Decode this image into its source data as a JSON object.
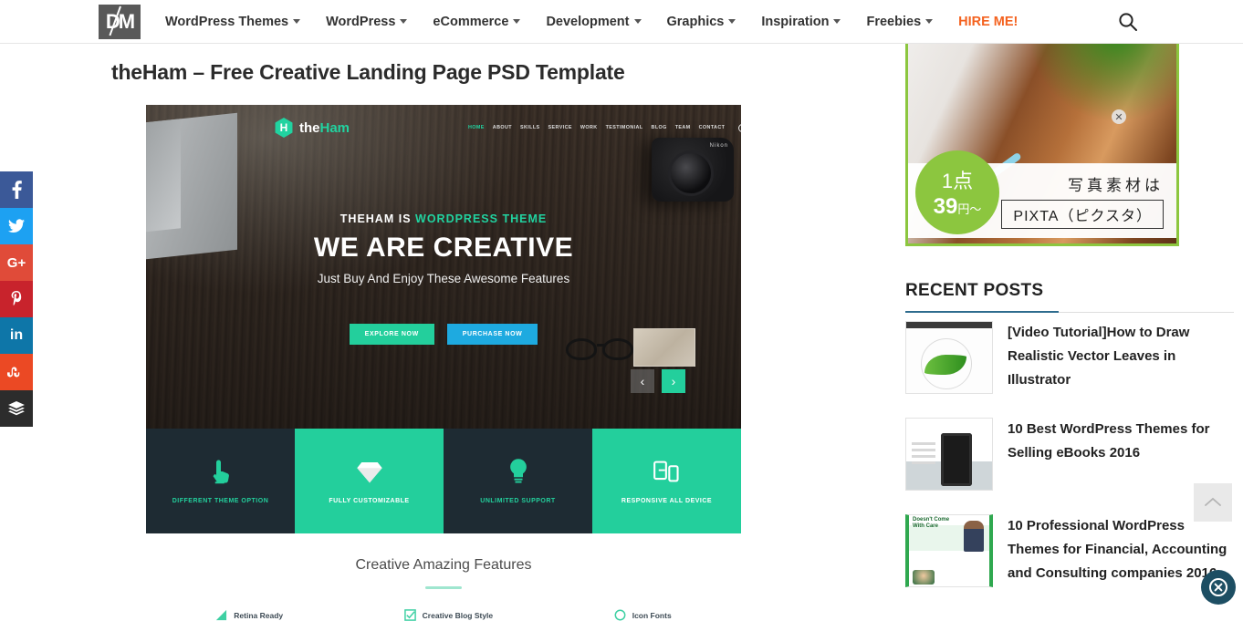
{
  "header": {
    "logo_text": "DM",
    "nav": [
      {
        "label": "WordPress Themes",
        "has_caret": true
      },
      {
        "label": "WordPress",
        "has_caret": true
      },
      {
        "label": "eCommerce",
        "has_caret": true
      },
      {
        "label": "Development",
        "has_caret": true
      },
      {
        "label": "Graphics",
        "has_caret": true
      },
      {
        "label": "Inspiration",
        "has_caret": true
      },
      {
        "label": "Freebies",
        "has_caret": true
      },
      {
        "label": "HIRE ME!",
        "has_caret": false
      }
    ],
    "search_icon": "search-icon",
    "accent_color": "#f4621f"
  },
  "social": [
    {
      "name": "facebook",
      "glyph": "f",
      "color": "#3b5998"
    },
    {
      "name": "twitter",
      "glyph": "ᵗ",
      "color": "#1da1f2"
    },
    {
      "name": "google-plus",
      "glyph": "G+",
      "color": "#e04b39"
    },
    {
      "name": "pinterest",
      "glyph": "p",
      "color": "#c8232c"
    },
    {
      "name": "linkedin",
      "glyph": "in",
      "color": "#0e76a8"
    },
    {
      "name": "stumbleupon",
      "glyph": "su",
      "color": "#eb4924"
    },
    {
      "name": "buffer",
      "glyph": "≡",
      "color": "#2c2c2c"
    }
  ],
  "article": {
    "title": "theHam – Free Creative Landing Page PSD Template"
  },
  "preview": {
    "brand": {
      "mark": "H",
      "name_dark": "the",
      "name_accent": "Ham"
    },
    "menu": [
      "HOME",
      "ABOUT",
      "SKILLS",
      "SERVICE",
      "WORK",
      "TESTIMONIAL",
      "BLOG",
      "TEAM",
      "CONTACT"
    ],
    "menu_active": "HOME",
    "hero": {
      "kicker_plain": "THEHAM IS ",
      "kicker_accent": "WORDPRESS THEME",
      "heading": "WE ARE CREATIVE",
      "subheading": "Just Buy And Enjoy These Awesome Features",
      "btn_explore": "EXPLORE NOW",
      "btn_purchase": "PURCHASE NOW"
    },
    "carousel": {
      "prev": "‹",
      "next": "›"
    },
    "camera_label": "Nikon",
    "features": [
      {
        "label": "DIFFERENT THEME OPTION",
        "icon": "touch-icon",
        "theme": "dark"
      },
      {
        "label": "FULLY CUSTOMIZABLE",
        "icon": "diamond-icon",
        "theme": "green"
      },
      {
        "label": "UNLIMITED SUPPORT",
        "icon": "lightbulb-icon",
        "theme": "dark"
      },
      {
        "label": "RESPONSIVE ALL DEVICE",
        "icon": "devices-icon",
        "theme": "green"
      }
    ],
    "section_title": "Creative Amazing Features",
    "sub_features": [
      {
        "label": "Retina Ready",
        "icon": "retina-icon"
      },
      {
        "label": "Creative Blog Style",
        "icon": "blog-icon"
      },
      {
        "label": "Icon Fonts",
        "icon": "fonts-icon"
      }
    ],
    "accent_green": "#23cf9c",
    "accent_blue": "#1eaae0",
    "dark_panel": "#1e2b33"
  },
  "sidebar": {
    "ad": {
      "badge_line1": "1点",
      "badge_line2_num": "39",
      "badge_line2_unit": "円～",
      "line1": "写真素材は",
      "line2": "PIXTA（ピクスタ）",
      "close": "✕",
      "border_color": "#8cc63f"
    },
    "recent_posts_heading": "RECENT POSTS",
    "posts": [
      {
        "title": "[Video Tutorial]How to Draw Realistic Vector Leaves in Illustrator",
        "thumb": "t1"
      },
      {
        "title": "10 Best WordPress Themes for Selling eBooks 2016",
        "thumb": "t2"
      },
      {
        "title": "10 Professional WordPress Themes for Financial, Accounting and Consulting companies 2016",
        "thumb": "t3"
      }
    ]
  },
  "floating": {
    "to_top_icon": "chevron-up-icon",
    "badge_icon": "close-circle-icon"
  }
}
